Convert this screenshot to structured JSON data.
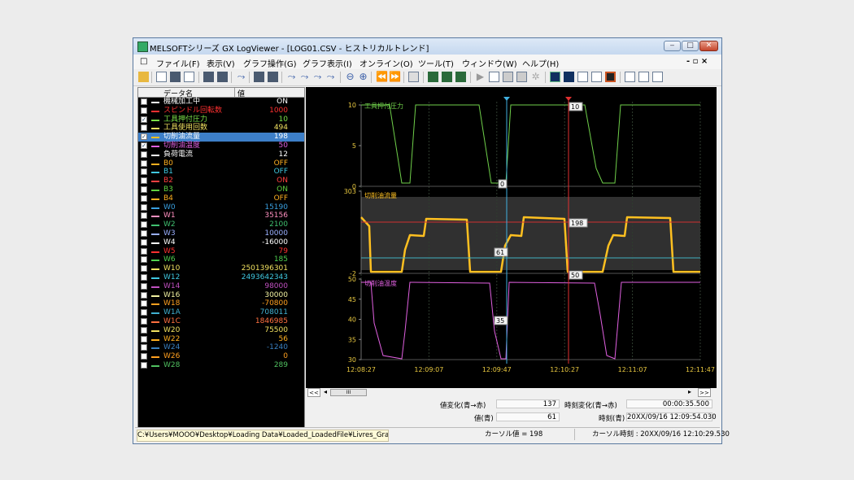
{
  "window": {
    "title": "MELSOFTシリーズ GX LogViewer - [LOG01.CSV - ヒストリカルトレンド]",
    "buttons": {
      "minimize": "‒",
      "maximize": "□",
      "close": "✕"
    },
    "mdi_controls": "- ▫ ×"
  },
  "menu": {
    "doc_icon": "□",
    "items": [
      "ファイル(F)",
      "表示(V)",
      "グラフ操作(G)",
      "グラフ表示(I)",
      "オンライン(O)",
      "ツール(T)",
      "ウィンドウ(W)",
      "ヘルプ(H)"
    ]
  },
  "data_list": {
    "header_name": "データ名",
    "header_value": "値",
    "rows": [
      {
        "name": "機械加工中",
        "value": "ON",
        "color": "#ffffff",
        "checked": ""
      },
      {
        "name": "スピンドル回転数",
        "value": "1000",
        "color": "#ff3030",
        "checked": ""
      },
      {
        "name": "工具押付圧力",
        "value": "10",
        "color": "#7ce048",
        "checked": "✓"
      },
      {
        "name": "工具使用回数",
        "value": "494",
        "color": "#f0e060",
        "checked": ""
      },
      {
        "name": "切削油流量",
        "value": "198",
        "color": "#ffc020",
        "checked": "✓"
      },
      {
        "name": "切削油温度",
        "value": "50",
        "color": "#e060e0",
        "checked": "✓"
      },
      {
        "name": "負荷電流",
        "value": "12",
        "color": "#ffffff",
        "checked": ""
      },
      {
        "name": "B0",
        "value": "OFF",
        "color": "#ffb020",
        "checked": ""
      },
      {
        "name": "B1",
        "value": "OFF",
        "color": "#40c8e0",
        "checked": ""
      },
      {
        "name": "B2",
        "value": "ON",
        "color": "#ff4040",
        "checked": ""
      },
      {
        "name": "B3",
        "value": "ON",
        "color": "#60d040",
        "checked": ""
      },
      {
        "name": "B4",
        "value": "OFF",
        "color": "#ffb020",
        "checked": ""
      },
      {
        "name": "W0",
        "value": "15190",
        "color": "#3aa0e0",
        "checked": ""
      },
      {
        "name": "W1",
        "value": "35156",
        "color": "#ff90c0",
        "checked": ""
      },
      {
        "name": "W2",
        "value": "2100",
        "color": "#40c070",
        "checked": ""
      },
      {
        "name": "W3",
        "value": "10000",
        "color": "#9ab0ff",
        "checked": ""
      },
      {
        "name": "W4",
        "value": "-16000",
        "color": "#ffffff",
        "checked": ""
      },
      {
        "name": "W5",
        "value": "79",
        "color": "#ff3030",
        "checked": ""
      },
      {
        "name": "W6",
        "value": "185",
        "color": "#50d050",
        "checked": ""
      },
      {
        "name": "W10",
        "value": "2501396301",
        "color": "#f0e060",
        "checked": ""
      },
      {
        "name": "W12",
        "value": "2493642343",
        "color": "#40c8e0",
        "checked": ""
      },
      {
        "name": "W14",
        "value": "98000",
        "color": "#c050c0",
        "checked": ""
      },
      {
        "name": "W16",
        "value": "30000",
        "color": "#f0f0a0",
        "checked": ""
      },
      {
        "name": "W18",
        "value": "-70800",
        "color": "#ffa020",
        "checked": ""
      },
      {
        "name": "W1A",
        "value": "708011",
        "color": "#40b0d0",
        "checked": ""
      },
      {
        "name": "W1C",
        "value": "1846985",
        "color": "#ff7040",
        "checked": ""
      },
      {
        "name": "W20",
        "value": "75500",
        "color": "#f0e060",
        "checked": ""
      },
      {
        "name": "W22",
        "value": "56",
        "color": "#ffb020",
        "checked": ""
      },
      {
        "name": "W24",
        "value": "-1240",
        "color": "#3a80c0",
        "checked": ""
      },
      {
        "name": "W26",
        "value": "0",
        "color": "#ffa020",
        "checked": ""
      },
      {
        "name": "W28",
        "value": "289",
        "color": "#50c060",
        "checked": ""
      }
    ]
  },
  "chart_data": [
    {
      "type": "line",
      "series": [
        {
          "name": "工具押付圧力",
          "color": "#6fcf4a"
        }
      ],
      "yticks": [
        "10",
        "5",
        "0"
      ],
      "ylim": [
        0,
        10
      ],
      "cursor_labels": {
        "red": "10",
        "cyan": "0"
      }
    },
    {
      "type": "line",
      "series": [
        {
          "name": "切削油流量",
          "color": "#ffc020"
        }
      ],
      "yticks": [
        "303",
        "-2"
      ],
      "ylim": [
        -2,
        303
      ],
      "cursor_labels": {
        "red": "50",
        "cyan": "61",
        "ref": "198"
      }
    },
    {
      "type": "line",
      "series": [
        {
          "name": "切削油温度",
          "color": "#e060e0"
        }
      ],
      "yticks": [
        "50",
        "45",
        "40",
        "35",
        "30"
      ],
      "ylim": [
        30,
        50
      ],
      "cursor_labels": {
        "cyan": "35"
      }
    }
  ],
  "time_axis": [
    "12:08:27",
    "12:09:07",
    "12:09:47",
    "12:10:27",
    "12:11:07",
    "12:11:47"
  ],
  "scroll": {
    "left": "<<",
    "right": ">>",
    "thumb": "III"
  },
  "info": {
    "value_change_label": "値変化(青→赤)",
    "value_change": "137",
    "time_change_label": "時刻変化(青→赤)",
    "time_change": "00:00:35.500",
    "value_blue_label": "値(青)",
    "value_blue": "61",
    "time_blue_label": "時刻(青)",
    "time_blue": "20XX/09/16 12:09:54.030"
  },
  "status": {
    "path": "C:¥Users¥MOOO¥Desktop¥Loading Data¥Loaded_LoadedFile¥Livres_Grad¥b...",
    "cursor_value": "カーソル値 = 198",
    "cursor_time": "カーソル時刻 : 20XX/09/16 12:10:29.530"
  }
}
